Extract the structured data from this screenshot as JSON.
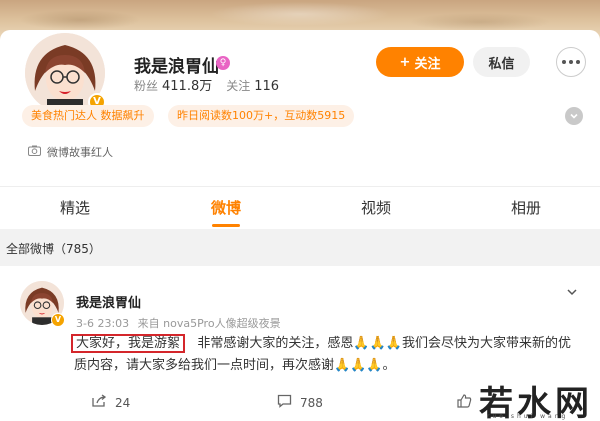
{
  "profile": {
    "name": "我是浪胃仙",
    "fans_label": "粉丝",
    "fans_count": "411.8万",
    "follow_label": "关注",
    "follow_count": "116",
    "follow_button": "关注",
    "message_button": "私信",
    "tags": [
      "美食热门达人 数据飙升",
      "昨日阅读数100万+，互动数5915"
    ],
    "story_label": "微博故事红人"
  },
  "tabs": [
    {
      "label": "精选",
      "active": false
    },
    {
      "label": "微博",
      "active": true
    },
    {
      "label": "视频",
      "active": false
    },
    {
      "label": "相册",
      "active": false
    }
  ],
  "section": {
    "title": "全部微博（785）"
  },
  "post": {
    "author": "我是浪胃仙",
    "time": "3-6 23:03",
    "source": "来自 nova5Pro人像超级夜景",
    "highlight": "大家好，我是游絮",
    "text_line1": "非常感谢大家的关注，感恩🙏🙏🙏我们会尽快为大家带来新的优",
    "text_line2": "质内容，请大家多给我们一点时间，再次感谢🙏🙏🙏。",
    "repost_count": "24",
    "comment_count": "788"
  },
  "watermark": {
    "text": "若水网",
    "sub": "ruo shui wang"
  },
  "colors": {
    "accent": "#ff8200",
    "verified": "#f5a300",
    "highlight_box": "#d4262b"
  },
  "icons": [
    "verified-badge-icon",
    "gender-icon",
    "more-icon",
    "expand-chevron-icon",
    "camera-icon",
    "repost-icon",
    "comment-icon",
    "like-icon",
    "chevron-down-icon"
  ]
}
